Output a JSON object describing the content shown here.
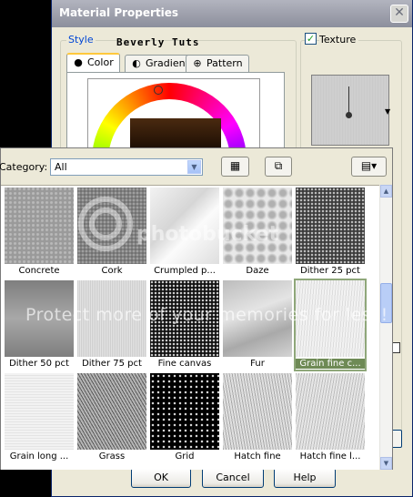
{
  "dialog": {
    "title": "Material Properties",
    "close_glyph": "✕",
    "style_group_label": "Style",
    "brand_text": "Beverly Tuts",
    "tabs": [
      {
        "label": "Color",
        "glyph": "●",
        "active": true
      },
      {
        "label": "Gradient",
        "glyph": "◐",
        "active": false
      },
      {
        "label": "Pattern",
        "glyph": "⊕",
        "active": false
      }
    ],
    "texture_checkbox": {
      "label": "Texture",
      "checked": true,
      "glyph": "✓"
    },
    "buttons": {
      "ok": "OK",
      "cancel": "Cancel",
      "help": "Help"
    }
  },
  "picker": {
    "category_label": "Category:",
    "category_value": "All",
    "icons": [
      "dropdown-arrow",
      "browse-icon",
      "copy-icon",
      "view-options-icon"
    ],
    "textures": [
      {
        "name": "Concrete",
        "pattern": "concrete"
      },
      {
        "name": "Cork",
        "pattern": "cork"
      },
      {
        "name": "Crumpled p...",
        "pattern": "crumpled"
      },
      {
        "name": "Daze",
        "pattern": "daze"
      },
      {
        "name": "Dither 25 pct",
        "pattern": "dither25"
      },
      {
        "name": "Dither 50 pct",
        "pattern": "dither50"
      },
      {
        "name": "Dither 75 pct",
        "pattern": "dither75"
      },
      {
        "name": "Fine canvas",
        "pattern": "finecanvas"
      },
      {
        "name": "Fur",
        "pattern": "fur"
      },
      {
        "name": "Grain fine c...",
        "pattern": "grainfine",
        "selected": true
      },
      {
        "name": "Grain long ...",
        "pattern": "grainlong"
      },
      {
        "name": "Grass",
        "pattern": "grass"
      },
      {
        "name": "Grid",
        "pattern": "grid"
      },
      {
        "name": "Hatch fine",
        "pattern": "hatchfine"
      },
      {
        "name": "Hatch fine l...",
        "pattern": "hatchfinel"
      }
    ]
  },
  "watermark": {
    "text": "Protect more of your memories for less!",
    "logo": "photobucket"
  },
  "colors": {
    "selection": "#6e8a55",
    "title_bar": "#9fa1ad",
    "dialog_bg": "#ece9d8"
  }
}
